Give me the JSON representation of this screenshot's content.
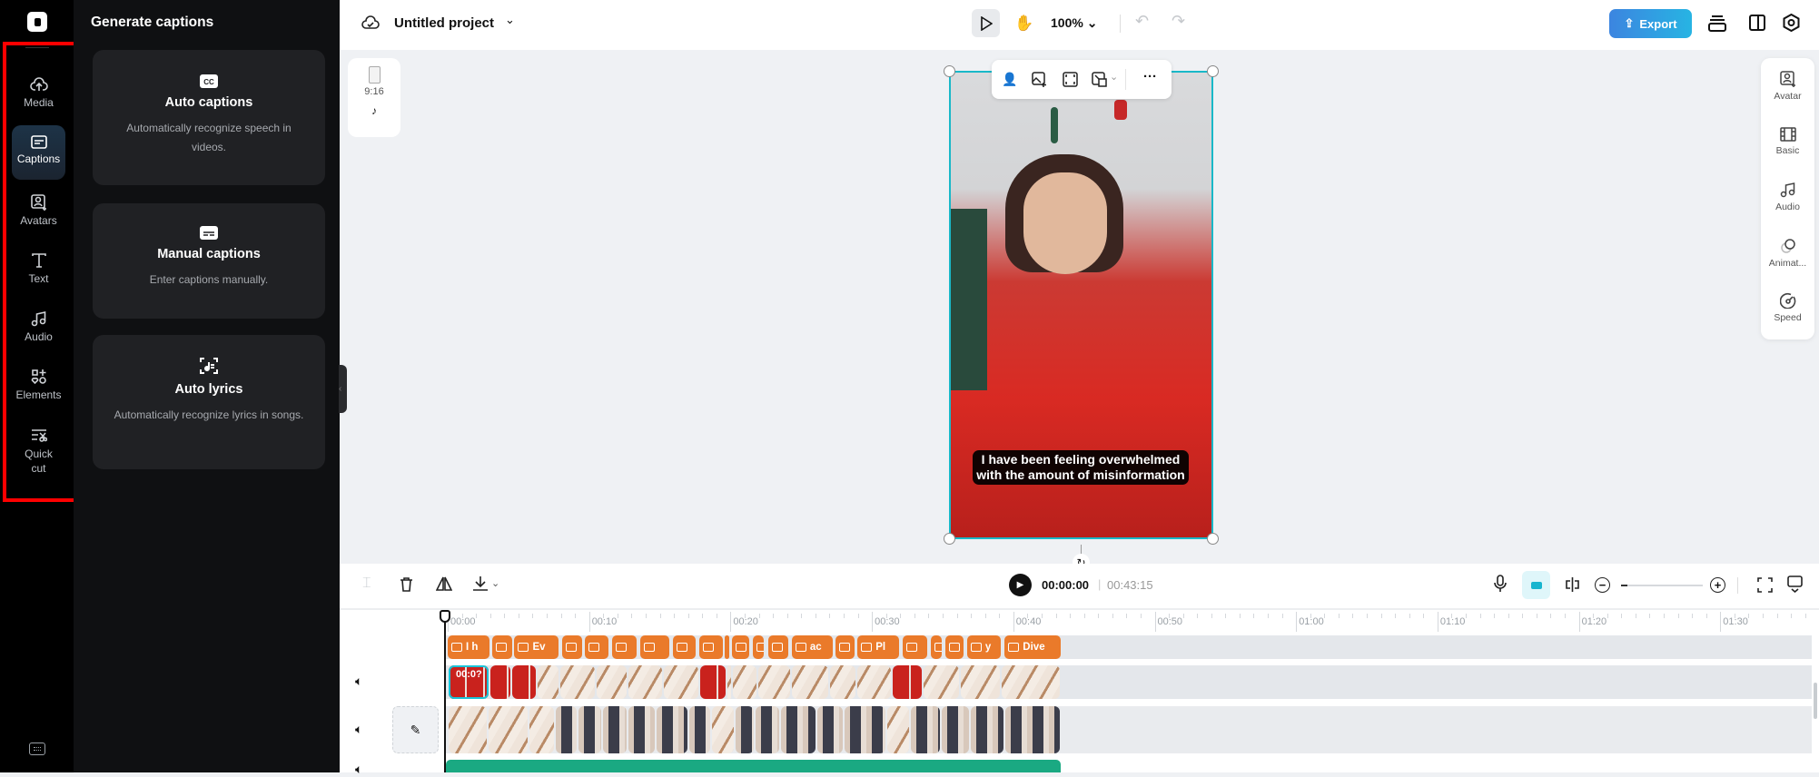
{
  "rail": {
    "items": [
      {
        "label": "Media"
      },
      {
        "label": "Captions"
      },
      {
        "label": "Avatars"
      },
      {
        "label": "Text"
      },
      {
        "label": "Audio"
      },
      {
        "label": "Elements"
      },
      {
        "label": "Quick",
        "label2": "cut"
      }
    ],
    "active": "Captions"
  },
  "panel": {
    "title": "Generate captions",
    "cards": [
      {
        "title": "Auto captions",
        "desc": "Automatically recognize speech in videos."
      },
      {
        "title": "Manual captions",
        "desc": "Enter captions manually."
      },
      {
        "title": "Auto lyrics",
        "desc": "Automatically recognize lyrics in songs."
      }
    ]
  },
  "topbar": {
    "project": "Untitled project",
    "zoom": "100%",
    "export": "Export"
  },
  "canvas": {
    "ratio": "9:16",
    "caption_line1": "I have been feeling overwhelmed",
    "caption_line2": "with the amount of misinformation"
  },
  "right_panel": {
    "items": [
      {
        "label": "Avatar"
      },
      {
        "label": "Basic"
      },
      {
        "label": "Audio"
      },
      {
        "label": "Animat..."
      },
      {
        "label": "Speed"
      }
    ]
  },
  "timeline": {
    "current": "00:00:00",
    "duration": "00:43:15",
    "selected_clip_label": "00:0?",
    "zoom_level": 0.08,
    "ruler": [
      "00:00",
      "00:10",
      "00:20",
      "00:30",
      "00:40",
      "00:50",
      "01:00",
      "01:10",
      "01:20",
      "01:30"
    ],
    "captions": [
      {
        "s": 0,
        "e": 2.95,
        "t": "I h"
      },
      {
        "s": 3.17,
        "e": 4.53,
        "t": ""
      },
      {
        "s": 4.72,
        "e": 7.85,
        "t": "Ev"
      },
      {
        "s": 8.11,
        "e": 9.51,
        "t": ""
      },
      {
        "s": 9.73,
        "e": 11.35,
        "t": ""
      },
      {
        "s": 11.61,
        "e": 13.38,
        "t": ""
      },
      {
        "s": 13.6,
        "e": 15.67,
        "t": ""
      },
      {
        "s": 15.92,
        "e": 17.51,
        "t": ""
      },
      {
        "s": 17.77,
        "e": 19.47,
        "t": ""
      },
      {
        "s": 19.62,
        "e": 19.91,
        "t": ""
      },
      {
        "s": 20.13,
        "e": 21.31,
        "t": "("
      },
      {
        "s": 21.57,
        "e": 22.34,
        "t": "|"
      },
      {
        "s": 22.64,
        "e": 24.11,
        "t": ""
      },
      {
        "s": 24.33,
        "e": 27.21,
        "t": "ac"
      },
      {
        "s": 27.4,
        "e": 28.76,
        "t": ""
      },
      {
        "s": 28.98,
        "e": 31.93,
        "t": "Pl"
      },
      {
        "s": 32.15,
        "e": 33.92,
        "t": ""
      },
      {
        "s": 34.14,
        "e": 34.95,
        "t": ""
      },
      {
        "s": 35.18,
        "e": 36.5,
        "t": ""
      },
      {
        "s": 36.73,
        "e": 39.13,
        "t": "y"
      },
      {
        "s": 39.39,
        "e": 43.37,
        "t": "Dive"
      }
    ],
    "video_cuts": [
      0,
      2.95,
      4.5,
      6.3,
      7.9,
      10.5,
      12.7,
      15.2,
      17.8,
      19.7,
      20.1,
      21.9,
      24.3,
      27,
      28.9,
      31.4,
      33.6,
      36.2,
      39.1,
      43.37
    ],
    "broll_cuts": [
      0,
      2.8,
      5.7,
      7.6,
      9.2,
      10.9,
      12.7,
      14.7,
      17,
      18.6,
      20.3,
      21.7,
      23.5,
      26.1,
      28,
      31,
      32.7,
      34.9,
      36.9,
      39.4,
      43.37
    ]
  }
}
